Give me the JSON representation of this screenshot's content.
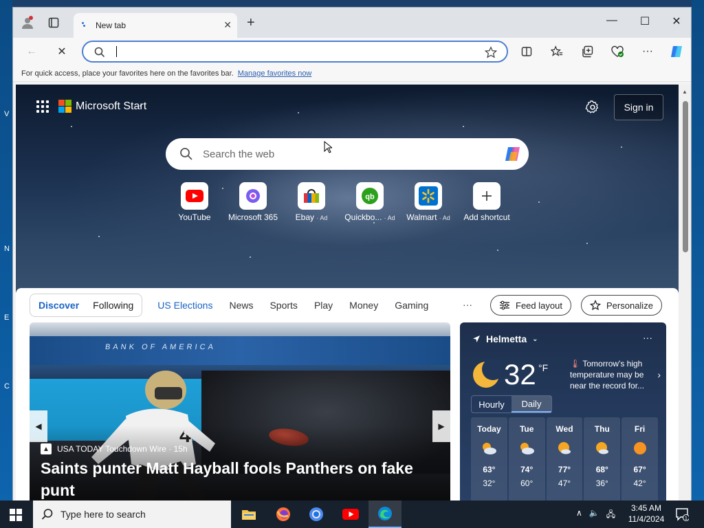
{
  "desktop": {
    "edge_letters": [
      "V",
      "N",
      "E",
      "C"
    ]
  },
  "browser": {
    "tab_title": "New tab",
    "favbar_text": "For quick access, place your favorites here on the favorites bar.",
    "favbar_link": "Manage favorites now"
  },
  "start": {
    "brand": "Microsoft Start",
    "signin": "Sign in",
    "search_placeholder": "Search the web",
    "shortcuts": [
      {
        "label": "YouTube",
        "ad": ""
      },
      {
        "label": "Microsoft 365",
        "ad": ""
      },
      {
        "label": "Ebay",
        "ad": "· Ad"
      },
      {
        "label": "Quickbo...",
        "ad": "· Ad"
      },
      {
        "label": "Walmart",
        "ad": "· Ad"
      },
      {
        "label": "Add shortcut",
        "ad": ""
      }
    ]
  },
  "feed": {
    "pill_tabs": [
      "Discover",
      "Following"
    ],
    "nav": [
      "US Elections",
      "News",
      "Sports",
      "Play",
      "Money",
      "Gaming"
    ],
    "more": "···",
    "feed_layout": "Feed layout",
    "personalize": "Personalize",
    "hero": {
      "stadium_text": "BANK OF AMERICA",
      "jersey_number": "4",
      "source": "USA TODAY Touchdown Wire · 15h",
      "headline": "Saints punter Matt Hayball fools Panthers on fake punt"
    }
  },
  "weather": {
    "location": "Helmetta",
    "temp": "32",
    "unit": "°F",
    "note": "Tomorrow's high temperature may be near the record for...",
    "toggle": [
      "Hourly",
      "Daily"
    ],
    "days": [
      {
        "name": "Today",
        "hi": "63°",
        "lo": "32°"
      },
      {
        "name": "Tue",
        "hi": "74°",
        "lo": "60°"
      },
      {
        "name": "Wed",
        "hi": "77°",
        "lo": "47°"
      },
      {
        "name": "Thu",
        "hi": "68°",
        "lo": "36°"
      },
      {
        "name": "Fri",
        "hi": "67°",
        "lo": "42°"
      }
    ]
  },
  "taskbar": {
    "search": "Type here to search",
    "time": "3:45 AM",
    "date": "11/4/2024",
    "notif_count": "1"
  },
  "colors": {
    "accent": "#1a63c6",
    "taskbar": "#17212e",
    "address_focus": "#4b7fd1"
  }
}
